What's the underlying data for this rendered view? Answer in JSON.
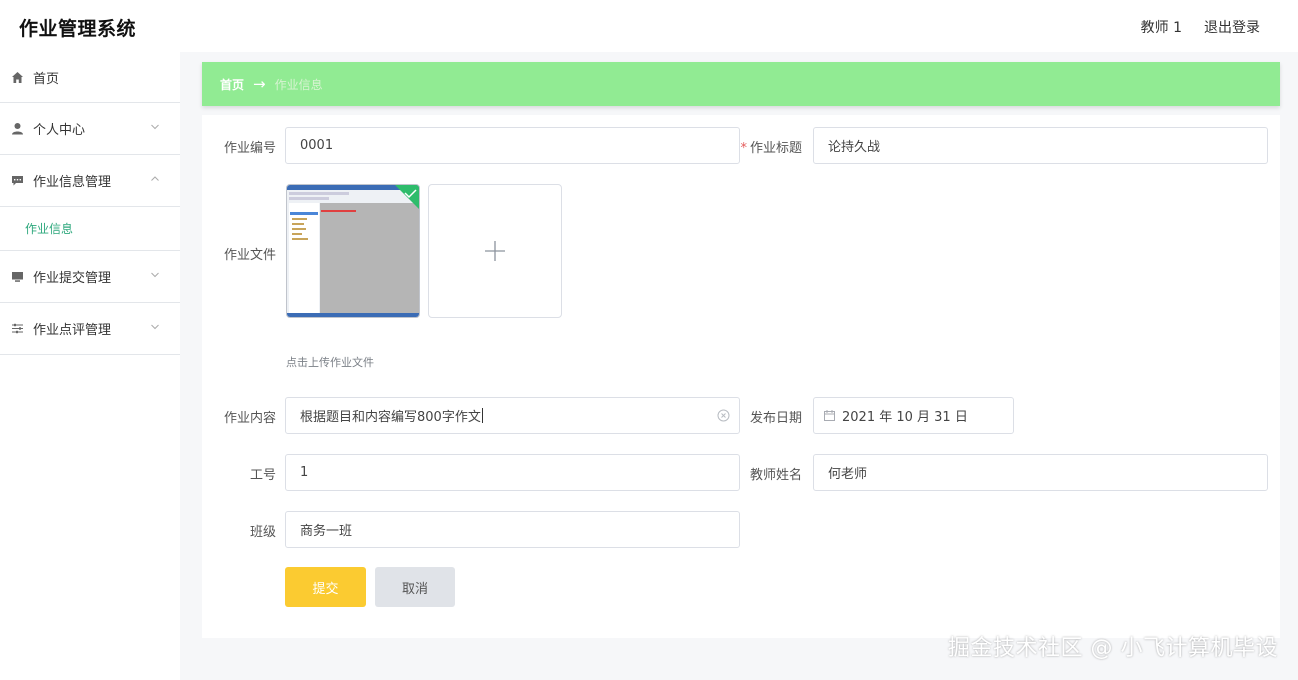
{
  "app": {
    "title": "作业管理系统"
  },
  "header": {
    "user": "教师 1",
    "logout": "退出登录"
  },
  "sidebar": {
    "items": [
      {
        "label": "首页",
        "icon": "home-icon"
      },
      {
        "label": "个人中心",
        "icon": "user-icon"
      },
      {
        "label": "作业信息管理",
        "icon": "chat-icon",
        "expanded": true,
        "sub": "作业信息"
      },
      {
        "label": "作业提交管理",
        "icon": "monitor-icon"
      },
      {
        "label": "作业点评管理",
        "icon": "sliders-icon"
      }
    ]
  },
  "breadcrumb": {
    "home": "首页",
    "arrow": "→",
    "current": "作业信息"
  },
  "form": {
    "id_label": "作业编号",
    "id_value": "0001",
    "title_label": "作业标题",
    "title_value": "论持久战",
    "required_mark": "*",
    "file_label": "作业文件",
    "file_hint": "点击上传作业文件",
    "add_icon": "plus-icon",
    "content_label": "作业内容",
    "content_value": "根据题目和内容编写800字作文",
    "date_label": "发布日期",
    "date_value": "2021 年 10 月 31 日",
    "staff_label": "工号",
    "staff_value": "1",
    "teacher_label": "教师姓名",
    "teacher_value": "何老师",
    "class_label": "班级",
    "class_value": "商务一班",
    "submit": "提交",
    "cancel": "取消"
  },
  "watermark": "掘金技术社区 @ 小飞计算机毕设",
  "colors": {
    "breadcrumb_bg": "#91eb93",
    "submit_bg": "#fbcb31",
    "active_sub": "#2ea87d"
  }
}
